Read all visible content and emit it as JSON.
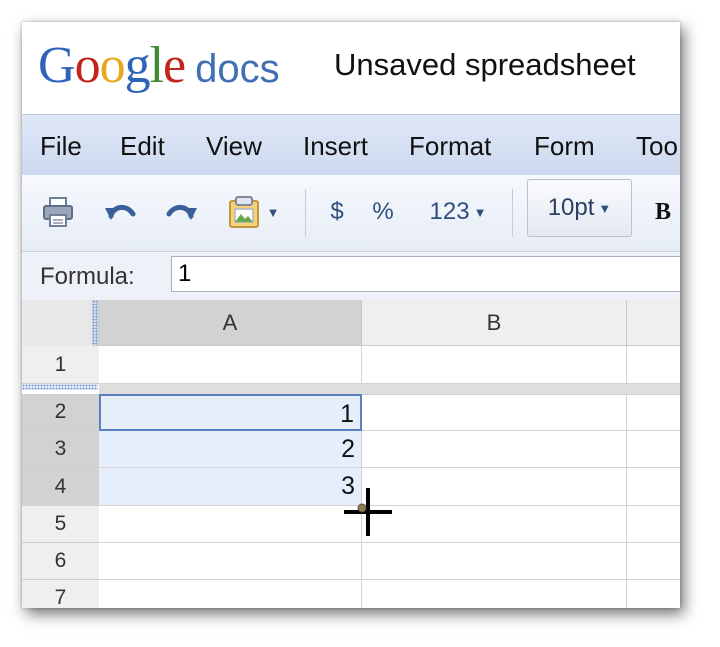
{
  "app": {
    "logo": {
      "google": "Google",
      "product": "docs"
    },
    "doc_title": "Unsaved spreadsheet"
  },
  "menu": [
    "File",
    "Edit",
    "View",
    "Insert",
    "Format",
    "Form",
    "Too"
  ],
  "toolbar": {
    "icons": [
      "print-icon",
      "undo-icon",
      "redo-icon",
      "paint-format-icon"
    ],
    "currency_label": "$",
    "percent_label": "%",
    "number_format_label": "123",
    "font_size_label": "10pt",
    "bold_label": "B"
  },
  "formula": {
    "label": "Formula:",
    "value": "1"
  },
  "grid": {
    "columns": [
      "A",
      "B"
    ],
    "rows": [
      "1",
      "2",
      "3",
      "4",
      "5",
      "6",
      "7"
    ],
    "cells": {
      "A2": "1",
      "A3": "2",
      "A4": "3"
    },
    "selection": "A2:A4"
  },
  "colors": {
    "menubar_bg": "#d4dff2",
    "selection_fill": "#e7eefb",
    "active_cell_border": "#5c7fbf",
    "header_gray": "#e8e8e8"
  }
}
